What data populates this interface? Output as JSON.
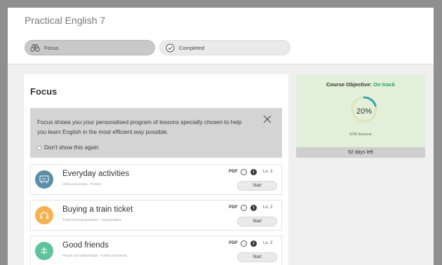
{
  "app": {
    "title": "Practical English 7"
  },
  "tabs": [
    {
      "label": "Focus",
      "icon": "binoculars-icon",
      "active": true
    },
    {
      "label": "Completed",
      "icon": "check-circle-icon",
      "active": false
    }
  ],
  "focus": {
    "heading": "Focus",
    "info_text": "Focus shows you your personalised program of lessons specially chosen to help you learn English in the most efficient way possible.",
    "dont_show_label": "Don't show this again",
    "lessons": [
      {
        "title": "Everyday activities",
        "subtitle": "Verbs and tenses - Present",
        "pdf_label": "PDF",
        "level": "Lv. 2",
        "start_label": "Start",
        "icon": "abc-board-icon",
        "color": "#5b8fa8"
      },
      {
        "title": "Buying a train ticket",
        "subtitle": "Travel and transportation - Transportation",
        "pdf_label": "PDF",
        "level": "Lv. 2",
        "start_label": "Start",
        "icon": "headphones-icon",
        "color": "#f7b24c"
      },
      {
        "title": "Good friends",
        "subtitle": "People and relationships - Family and friends",
        "pdf_label": "PDF",
        "level": "Lv. 2",
        "start_label": "Start",
        "icon": "balance-icon",
        "color": "#5cc39a"
      }
    ]
  },
  "objective": {
    "title": "Course Objective:",
    "status": "On track",
    "percent_label": "20%",
    "progress_fraction": 0.2,
    "lessons_label": "6/30 lessons",
    "days_left": "92 days left",
    "colors": {
      "track": "#dfe5b6",
      "progress": "#3aa6b0",
      "status": "#1f9e57"
    }
  }
}
